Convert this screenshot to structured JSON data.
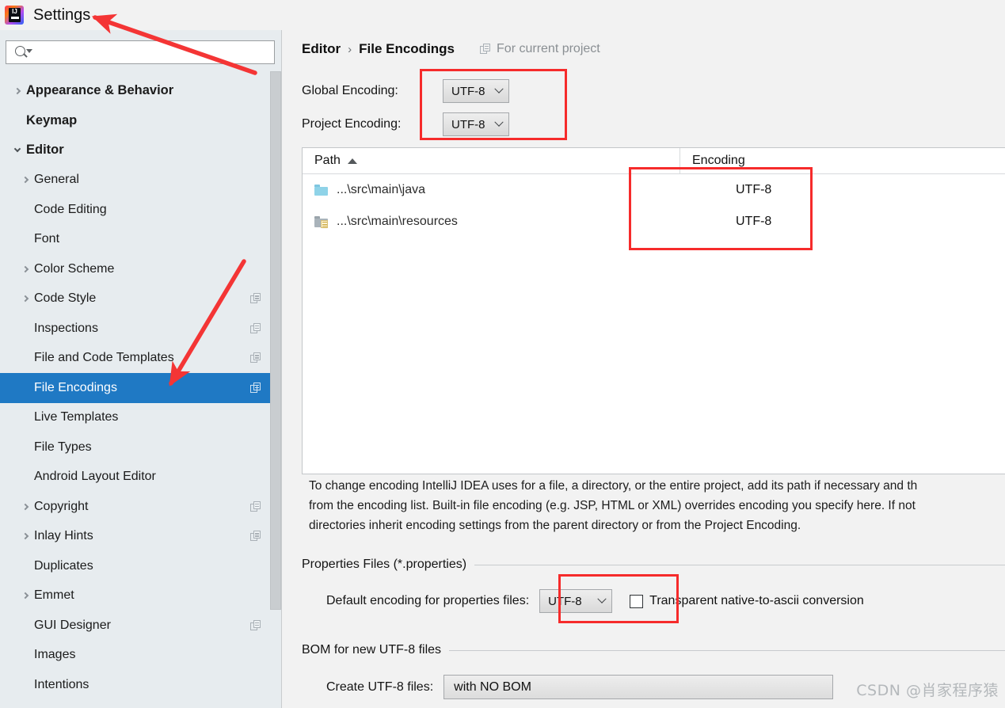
{
  "window": {
    "title": "Settings",
    "logo_icon": "intellij-idea-logo"
  },
  "sidebar": {
    "search": {
      "placeholder": "",
      "value": "",
      "icon": "search-icon"
    },
    "items": [
      {
        "label": "Appearance & Behavior",
        "expandable": true,
        "expanded": false,
        "bold": true,
        "indent": 0,
        "copy_icon": false,
        "selected": false
      },
      {
        "label": "Keymap",
        "expandable": false,
        "expanded": false,
        "bold": true,
        "indent": 0,
        "copy_icon": false,
        "selected": false
      },
      {
        "label": "Editor",
        "expandable": true,
        "expanded": true,
        "bold": true,
        "indent": 0,
        "copy_icon": false,
        "selected": false
      },
      {
        "label": "General",
        "expandable": true,
        "expanded": false,
        "bold": false,
        "indent": 1,
        "copy_icon": false,
        "selected": false
      },
      {
        "label": "Code Editing",
        "expandable": false,
        "expanded": false,
        "bold": false,
        "indent": 1,
        "copy_icon": false,
        "selected": false
      },
      {
        "label": "Font",
        "expandable": false,
        "expanded": false,
        "bold": false,
        "indent": 1,
        "copy_icon": false,
        "selected": false
      },
      {
        "label": "Color Scheme",
        "expandable": true,
        "expanded": false,
        "bold": false,
        "indent": 1,
        "copy_icon": false,
        "selected": false
      },
      {
        "label": "Code Style",
        "expandable": true,
        "expanded": false,
        "bold": false,
        "indent": 1,
        "copy_icon": true,
        "selected": false
      },
      {
        "label": "Inspections",
        "expandable": false,
        "expanded": false,
        "bold": false,
        "indent": 1,
        "copy_icon": true,
        "selected": false
      },
      {
        "label": "File and Code Templates",
        "expandable": false,
        "expanded": false,
        "bold": false,
        "indent": 1,
        "copy_icon": true,
        "selected": false
      },
      {
        "label": "File Encodings",
        "expandable": false,
        "expanded": false,
        "bold": false,
        "indent": 1,
        "copy_icon": true,
        "selected": true
      },
      {
        "label": "Live Templates",
        "expandable": false,
        "expanded": false,
        "bold": false,
        "indent": 1,
        "copy_icon": false,
        "selected": false
      },
      {
        "label": "File Types",
        "expandable": false,
        "expanded": false,
        "bold": false,
        "indent": 1,
        "copy_icon": false,
        "selected": false
      },
      {
        "label": "Android Layout Editor",
        "expandable": false,
        "expanded": false,
        "bold": false,
        "indent": 1,
        "copy_icon": false,
        "selected": false
      },
      {
        "label": "Copyright",
        "expandable": true,
        "expanded": false,
        "bold": false,
        "indent": 1,
        "copy_icon": true,
        "selected": false
      },
      {
        "label": "Inlay Hints",
        "expandable": true,
        "expanded": false,
        "bold": false,
        "indent": 1,
        "copy_icon": true,
        "selected": false
      },
      {
        "label": "Duplicates",
        "expandable": false,
        "expanded": false,
        "bold": false,
        "indent": 1,
        "copy_icon": false,
        "selected": false
      },
      {
        "label": "Emmet",
        "expandable": true,
        "expanded": false,
        "bold": false,
        "indent": 1,
        "copy_icon": false,
        "selected": false
      },
      {
        "label": "GUI Designer",
        "expandable": false,
        "expanded": false,
        "bold": false,
        "indent": 1,
        "copy_icon": true,
        "selected": false
      },
      {
        "label": "Images",
        "expandable": false,
        "expanded": false,
        "bold": false,
        "indent": 1,
        "copy_icon": false,
        "selected": false
      },
      {
        "label": "Intentions",
        "expandable": false,
        "expanded": false,
        "bold": false,
        "indent": 1,
        "copy_icon": false,
        "selected": false
      }
    ]
  },
  "main": {
    "breadcrumb": {
      "parent": "Editor",
      "separator": "›",
      "current": "File Encodings",
      "scope_label": "For current project",
      "scope_icon": "copy-scope-icon"
    },
    "global_encoding": {
      "label": "Global Encoding:",
      "value": "UTF-8"
    },
    "project_encoding": {
      "label": "Project Encoding:",
      "value": "UTF-8"
    },
    "table": {
      "columns": [
        "Path",
        "Encoding"
      ],
      "sort_column": "Path",
      "sort_direction": "asc",
      "rows": [
        {
          "icon": "folder-source-icon",
          "path": "...\\src\\main\\java",
          "encoding": "UTF-8"
        },
        {
          "icon": "folder-resources-icon",
          "path": "...\\src\\main\\resources",
          "encoding": "UTF-8"
        }
      ]
    },
    "description": [
      "To change encoding IntelliJ IDEA uses for a file, a directory, or the entire project, add its path if necessary and th",
      "from the encoding list. Built-in file encoding (e.g. JSP, HTML or XML) overrides encoding you specify here. If not",
      "directories inherit encoding settings from the parent directory or from the Project Encoding."
    ],
    "properties_section": {
      "title": "Properties Files (*.properties)",
      "default_encoding_label": "Default encoding for properties files:",
      "default_encoding_value": "UTF-8",
      "transparent_label": "Transparent native-to-ascii conversion",
      "transparent_checked": false
    },
    "bom_section": {
      "title": "BOM for new UTF-8 files",
      "create_label": "Create UTF-8 files:",
      "create_value": "with NO BOM"
    }
  },
  "annotations": {
    "highlight_color": "#f62b2b",
    "arrow_color": "#f43535",
    "boxes": [
      "encoding-dropdowns-box",
      "table-encoding-column-box",
      "properties-encoding-box"
    ],
    "arrows": [
      "arrow-to-settings-title",
      "arrow-to-file-encodings-item"
    ]
  },
  "watermark": {
    "text": "CSDN @肖家程序猿"
  }
}
